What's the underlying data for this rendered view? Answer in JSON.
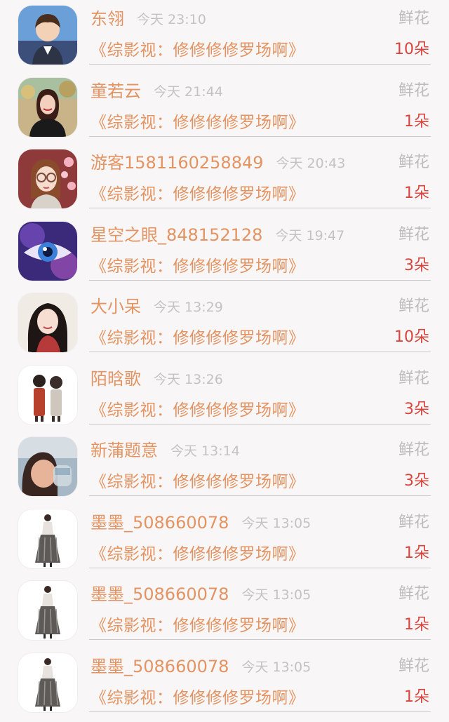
{
  "rows": [
    {
      "name": "东翎",
      "time": "今天 23:10",
      "gift": "鲜花",
      "show": "《综影视：修修修修罗场啊》",
      "count": "10朵",
      "avatar": "boy-avatar-icon"
    },
    {
      "name": "童若云",
      "time": "今天 21:44",
      "gift": "鲜花",
      "show": "《综影视：修修修修罗场啊》",
      "count": "1朵",
      "avatar": "woman-photo-avatar-icon"
    },
    {
      "name": "游客1581160258849",
      "time": "今天 20:43",
      "gift": "鲜花",
      "show": "《综影视：修修修修罗场啊》",
      "count": "1朵",
      "avatar": "glasses-girl-avatar-icon"
    },
    {
      "name": "星空之眼_848152128",
      "time": "今天 19:47",
      "gift": "鲜花",
      "show": "《综影视：修修修修罗场啊》",
      "count": "3朵",
      "avatar": "eye-avatar-icon"
    },
    {
      "name": "大小呆",
      "time": "今天 13:29",
      "gift": "鲜花",
      "show": "《综影视：修修修修罗场啊》",
      "count": "10朵",
      "avatar": "dark-hair-girl-avatar-icon"
    },
    {
      "name": "陌晗歌",
      "time": "今天 13:26",
      "gift": "鲜花",
      "show": "《综影视：修修修修罗场啊》",
      "count": "3朵",
      "avatar": "couple-avatar-icon"
    },
    {
      "name": "新蒲题意",
      "time": "今天 13:14",
      "gift": "鲜花",
      "show": "《综影视：修修修修罗场啊》",
      "count": "3朵",
      "avatar": "child-drinking-avatar-icon"
    },
    {
      "name": "墨墨_508660078",
      "time": "今天 13:05",
      "gift": "鲜花",
      "show": "《综影视：修修修修罗场啊》",
      "count": "1朵",
      "avatar": "fashion-sketch-avatar-icon"
    },
    {
      "name": "墨墨_508660078",
      "time": "今天 13:05",
      "gift": "鲜花",
      "show": "《综影视：修修修修罗场啊》",
      "count": "1朵",
      "avatar": "fashion-sketch-avatar-icon"
    },
    {
      "name": "墨墨_508660078",
      "time": "今天 13:05",
      "gift": "鲜花",
      "show": "《综影视：修修修修罗场啊》",
      "count": "1朵",
      "avatar": "fashion-sketch-avatar-icon"
    }
  ],
  "colors": {
    "name": "#e49462",
    "time": "#c3c3c3",
    "gift": "#bcbcbc",
    "count": "#d8453f",
    "background": "#f8f6f7"
  }
}
